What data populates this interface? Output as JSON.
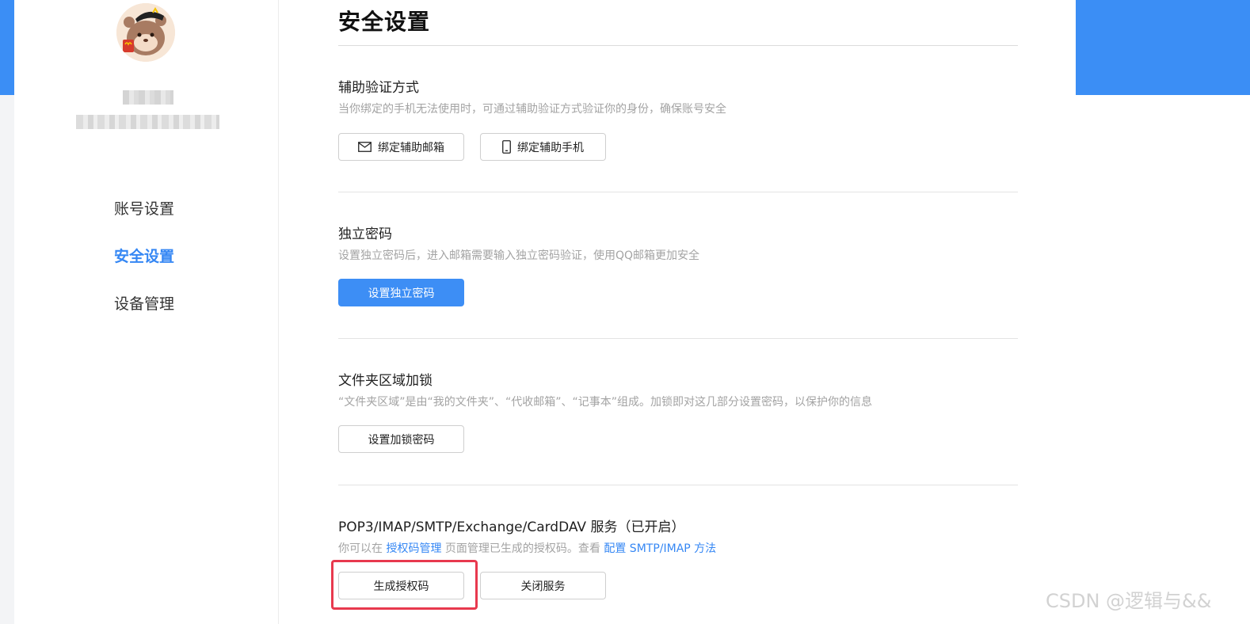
{
  "colors": {
    "accent": "#3587f4",
    "header_band": "#3b8ef5",
    "highlight": "#e8394e"
  },
  "sidebar": {
    "avatar_icon": "bear-avatar-icon",
    "items": [
      {
        "label": "账号设置",
        "active": false
      },
      {
        "label": "安全设置",
        "active": true
      },
      {
        "label": "设备管理",
        "active": false
      }
    ]
  },
  "main": {
    "title": "安全设置",
    "sections": [
      {
        "title": "辅助验证方式",
        "desc": "当你绑定的手机无法使用时，可通过辅助验证方式验证你的身份，确保账号安全",
        "buttons": [
          {
            "label": "绑定辅助邮箱",
            "icon": "mail-icon"
          },
          {
            "label": "绑定辅助手机",
            "icon": "phone-icon"
          }
        ]
      },
      {
        "title": "独立密码",
        "desc": "设置独立密码后，进入邮箱需要输入独立密码验证，使用QQ邮箱更加安全",
        "buttons": [
          {
            "label": "设置独立密码"
          }
        ]
      },
      {
        "title": "文件夹区域加锁",
        "desc": "“文件夹区域”是由“我的文件夹”、“代收邮箱”、“记事本”组成。加锁即对这几部分设置密码，以保护你的信息",
        "buttons": [
          {
            "label": "设置加锁密码"
          }
        ]
      },
      {
        "title": "POP3/IMAP/SMTP/Exchange/CardDAV 服务（已开启）",
        "desc_parts": {
          "prefix": "你可以在 ",
          "link1": "授权码管理",
          "middle": " 页面管理已生成的授权码。查看 ",
          "link2": "配置 SMTP/IMAP 方法"
        },
        "buttons": [
          {
            "label": "生成授权码"
          },
          {
            "label": "关闭服务"
          }
        ]
      }
    ]
  },
  "watermark": "CSDN @逻辑与&&"
}
